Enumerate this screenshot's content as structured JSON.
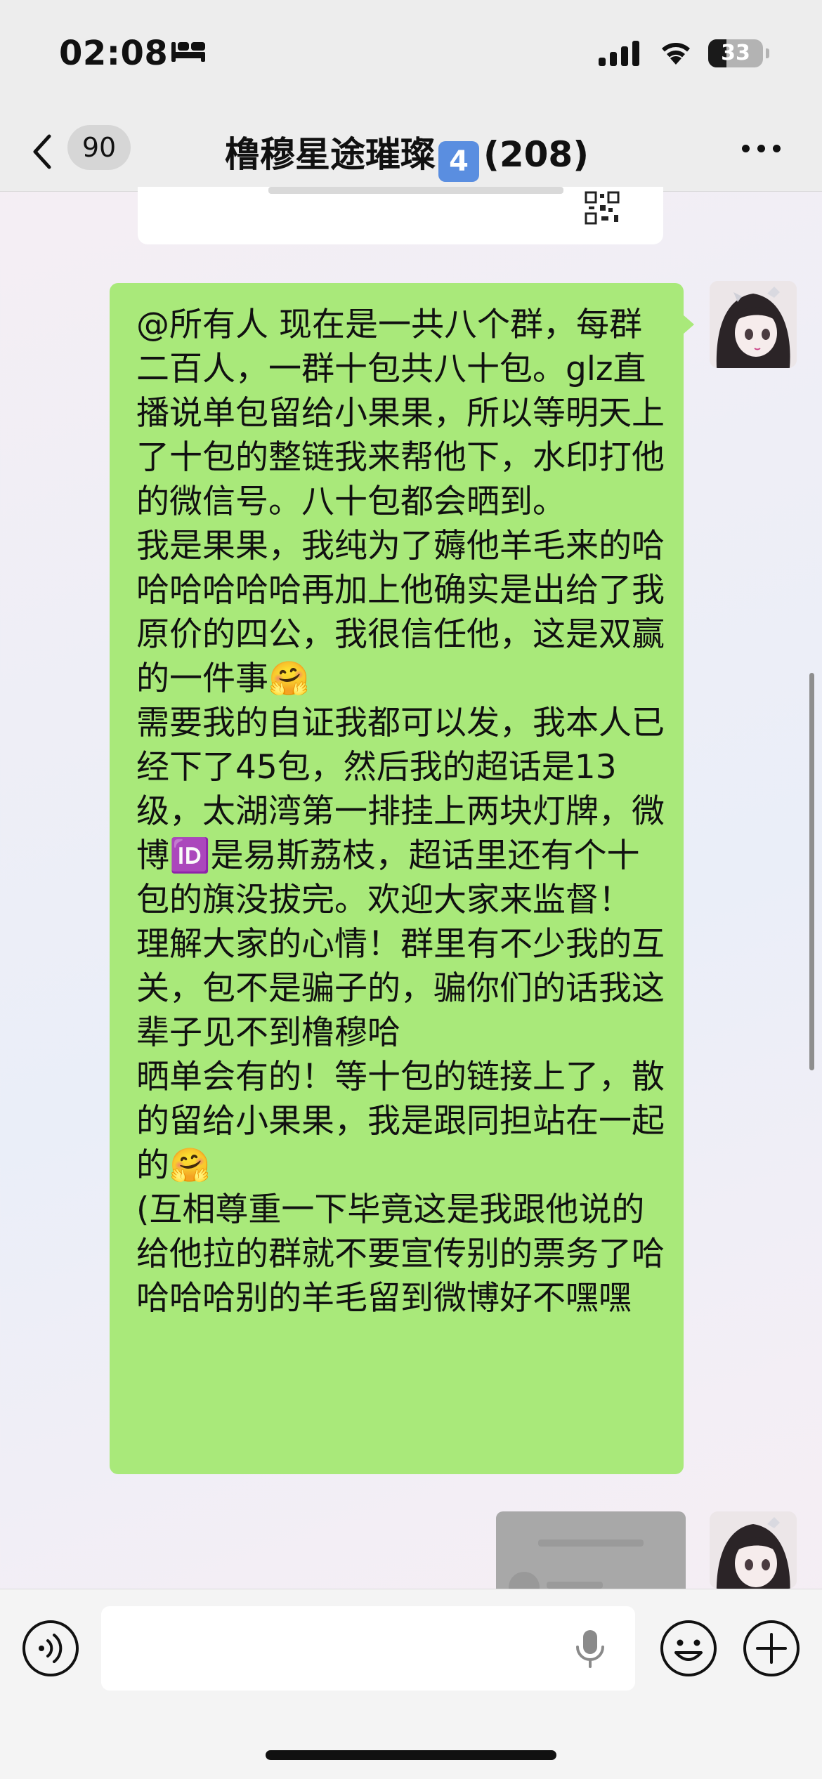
{
  "status_bar": {
    "time": "02:08",
    "focus_icon": "bed-icon",
    "battery_level": "33",
    "battery_fraction": 0.33
  },
  "nav": {
    "back_icon": "chevron-left-icon",
    "unread_count": "90",
    "title_name": "橹穆星途璀璨",
    "title_badge": "4",
    "title_count": "(208)",
    "more_icon": "ellipsis-icon"
  },
  "message": {
    "text": "@所有人 现在是一共八个群，每群二百人，一群十包共八十包。glz直播说单包留给小果果，所以等明天上了十包的整链我来帮他下，水印打他的微信号。八十包都会晒到。\n我是果果，我纯为了薅他羊毛来的哈哈哈哈哈哈再加上他确实是出给了我原价的四公，我很信任他，这是双赢的一件事🤗\n需要我的自证我都可以发，我本人已经下了45包，然后我的超话是13级，太湖湾第一排挂上两块灯牌，微博🆔是易斯荔枝，超话里还有个十包的旗没拔完。欢迎大家来监督！\n理解大家的心情！群里有不少我的互关，包不是骗子的，骗你们的话我这辈子见不到橹穆哈\n晒单会有的！等十包的链接上了，散的留给小果果，我是跟同担站在一起的🤗\n(互相尊重一下毕竟这是我跟他说的给他拉的群就不要宣传别的票务了哈哈哈哈别的羊毛留到微博好不嘿嘿"
  },
  "input_bar": {
    "voice_icon": "voice-icon",
    "mic_icon": "microphone-icon",
    "emoji_icon": "emoji-icon",
    "plus_icon": "plus-icon",
    "placeholder": ""
  },
  "colors": {
    "bubble": "#a9e97a",
    "bar": "#ededed",
    "badge": "#5a8ee0"
  }
}
